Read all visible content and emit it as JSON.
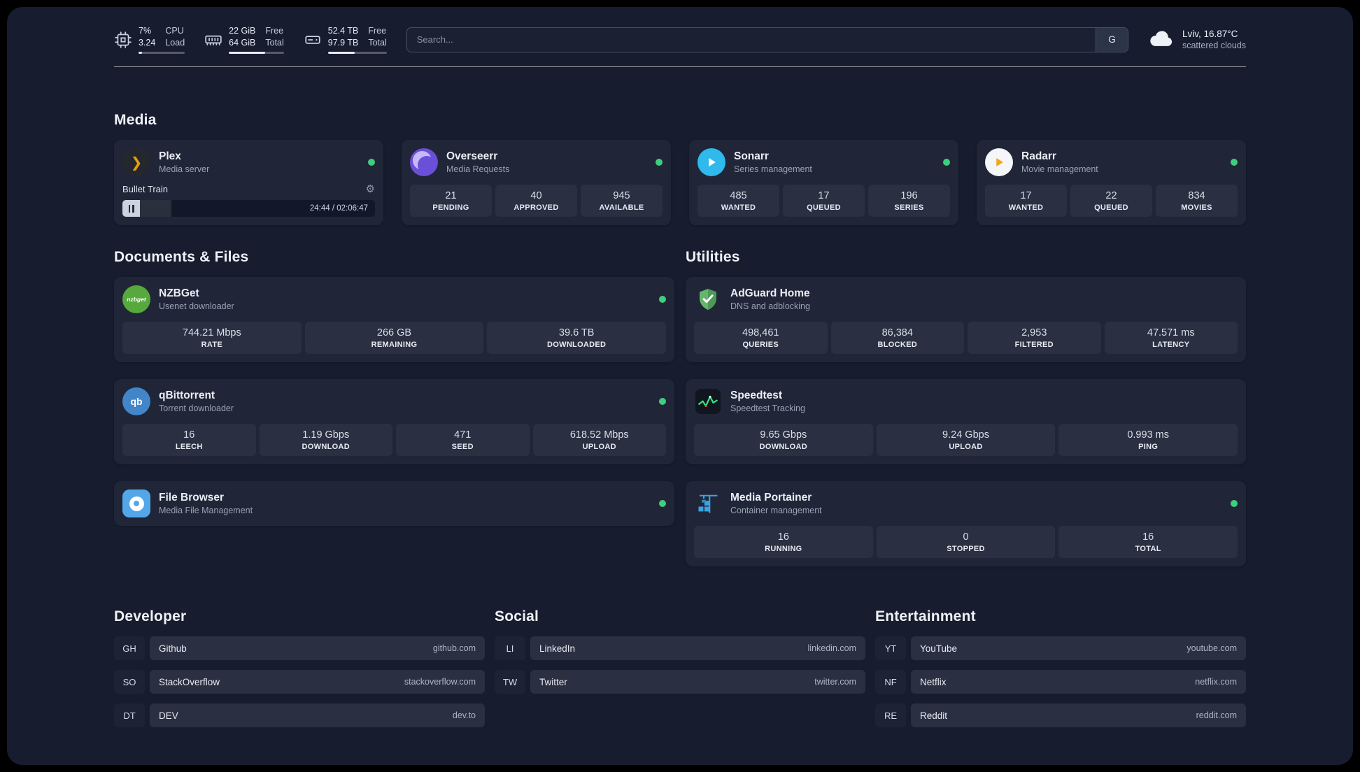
{
  "colors": {
    "page_background": "#171d2f",
    "card_background": "#202637",
    "tile_background": "#2a3041",
    "status_online": "#3ecf7e",
    "plex_accent": "#e5a00d",
    "adguard_green": "#68b46f",
    "speedtest_line_green": "#3ddc84",
    "portainer_blue": "#3aa3e3"
  },
  "icons": {
    "plex_glyph": "❯",
    "qbittorrent_glyph": "qb",
    "nzbget_glyph": "nzbget",
    "gear_glyph": "⚙"
  },
  "topbar": {
    "resources": [
      {
        "icon": "cpu-icon",
        "values": [
          "7%",
          "3.24"
        ],
        "labels": [
          "CPU",
          "Load"
        ],
        "percent_used": 7
      },
      {
        "icon": "memory-icon",
        "values": [
          "22 GiB",
          "64 GiB"
        ],
        "labels": [
          "Free",
          "Total"
        ],
        "percent_used": 66
      },
      {
        "icon": "disk-icon",
        "values": [
          "52.4 TB",
          "97.9 TB"
        ],
        "labels": [
          "Free",
          "Total"
        ],
        "percent_used": 46
      }
    ],
    "search": {
      "placeholder": "Search...",
      "button_label": "G"
    },
    "weather": {
      "location": "Lviv, 16.87°C",
      "condition": "scattered clouds"
    }
  },
  "media_section": {
    "title": "Media",
    "cards": [
      {
        "name": "Plex",
        "description": "Media server",
        "status": "online",
        "now_playing": {
          "title": "Bullet Train",
          "time": "24:44 / 02:06:47"
        }
      },
      {
        "name": "Overseerr",
        "description": "Media Requests",
        "status": "online",
        "stats": [
          {
            "value": "21",
            "label": "PENDING"
          },
          {
            "value": "40",
            "label": "APPROVED"
          },
          {
            "value": "945",
            "label": "AVAILABLE"
          }
        ]
      },
      {
        "name": "Sonarr",
        "description": "Series management",
        "status": "online",
        "stats": [
          {
            "value": "485",
            "label": "WANTED"
          },
          {
            "value": "17",
            "label": "QUEUED"
          },
          {
            "value": "196",
            "label": "SERIES"
          }
        ]
      },
      {
        "name": "Radarr",
        "description": "Movie management",
        "status": "online",
        "stats": [
          {
            "value": "17",
            "label": "WANTED"
          },
          {
            "value": "22",
            "label": "QUEUED"
          },
          {
            "value": "834",
            "label": "MOVIES"
          }
        ]
      }
    ]
  },
  "documents_section": {
    "title": "Documents & Files",
    "cards": [
      {
        "name": "NZBGet",
        "description": "Usenet downloader",
        "status": "online",
        "stats": [
          {
            "value": "744.21 Mbps",
            "label": "RATE"
          },
          {
            "value": "266 GB",
            "label": "REMAINING"
          },
          {
            "value": "39.6 TB",
            "label": "DOWNLOADED"
          }
        ]
      },
      {
        "name": "qBittorrent",
        "description": "Torrent downloader",
        "status": "online",
        "stats": [
          {
            "value": "16",
            "label": "LEECH"
          },
          {
            "value": "1.19 Gbps",
            "label": "DOWNLOAD"
          },
          {
            "value": "471",
            "label": "SEED"
          },
          {
            "value": "618.52 Mbps",
            "label": "UPLOAD"
          }
        ]
      },
      {
        "name": "File Browser",
        "description": "Media File Management",
        "status": "online"
      }
    ]
  },
  "utilities_section": {
    "title": "Utilities",
    "cards": [
      {
        "name": "AdGuard Home",
        "description": "DNS and adblocking",
        "stats": [
          {
            "value": "498,461",
            "label": "QUERIES"
          },
          {
            "value": "86,384",
            "label": "BLOCKED"
          },
          {
            "value": "2,953",
            "label": "FILTERED"
          },
          {
            "value": "47.571 ms",
            "label": "LATENCY"
          }
        ]
      },
      {
        "name": "Speedtest",
        "description": "Speedtest Tracking",
        "stats": [
          {
            "value": "9.65 Gbps",
            "label": "DOWNLOAD"
          },
          {
            "value": "9.24 Gbps",
            "label": "UPLOAD"
          },
          {
            "value": "0.993 ms",
            "label": "PING"
          }
        ]
      },
      {
        "name": "Media Portainer",
        "description": "Container management",
        "status": "online",
        "stats": [
          {
            "value": "16",
            "label": "RUNNING"
          },
          {
            "value": "0",
            "label": "STOPPED"
          },
          {
            "value": "16",
            "label": "TOTAL"
          }
        ]
      }
    ]
  },
  "bookmark_sections": [
    {
      "title": "Developer",
      "items": [
        {
          "abbr": "GH",
          "name": "Github",
          "url": "github.com"
        },
        {
          "abbr": "SO",
          "name": "StackOverflow",
          "url": "stackoverflow.com"
        },
        {
          "abbr": "DT",
          "name": "DEV",
          "url": "dev.to"
        }
      ]
    },
    {
      "title": "Social",
      "items": [
        {
          "abbr": "LI",
          "name": "LinkedIn",
          "url": "linkedin.com"
        },
        {
          "abbr": "TW",
          "name": "Twitter",
          "url": "twitter.com"
        }
      ]
    },
    {
      "title": "Entertainment",
      "items": [
        {
          "abbr": "YT",
          "name": "YouTube",
          "url": "youtube.com"
        },
        {
          "abbr": "NF",
          "name": "Netflix",
          "url": "netflix.com"
        },
        {
          "abbr": "RE",
          "name": "Reddit",
          "url": "reddit.com"
        }
      ]
    }
  ]
}
